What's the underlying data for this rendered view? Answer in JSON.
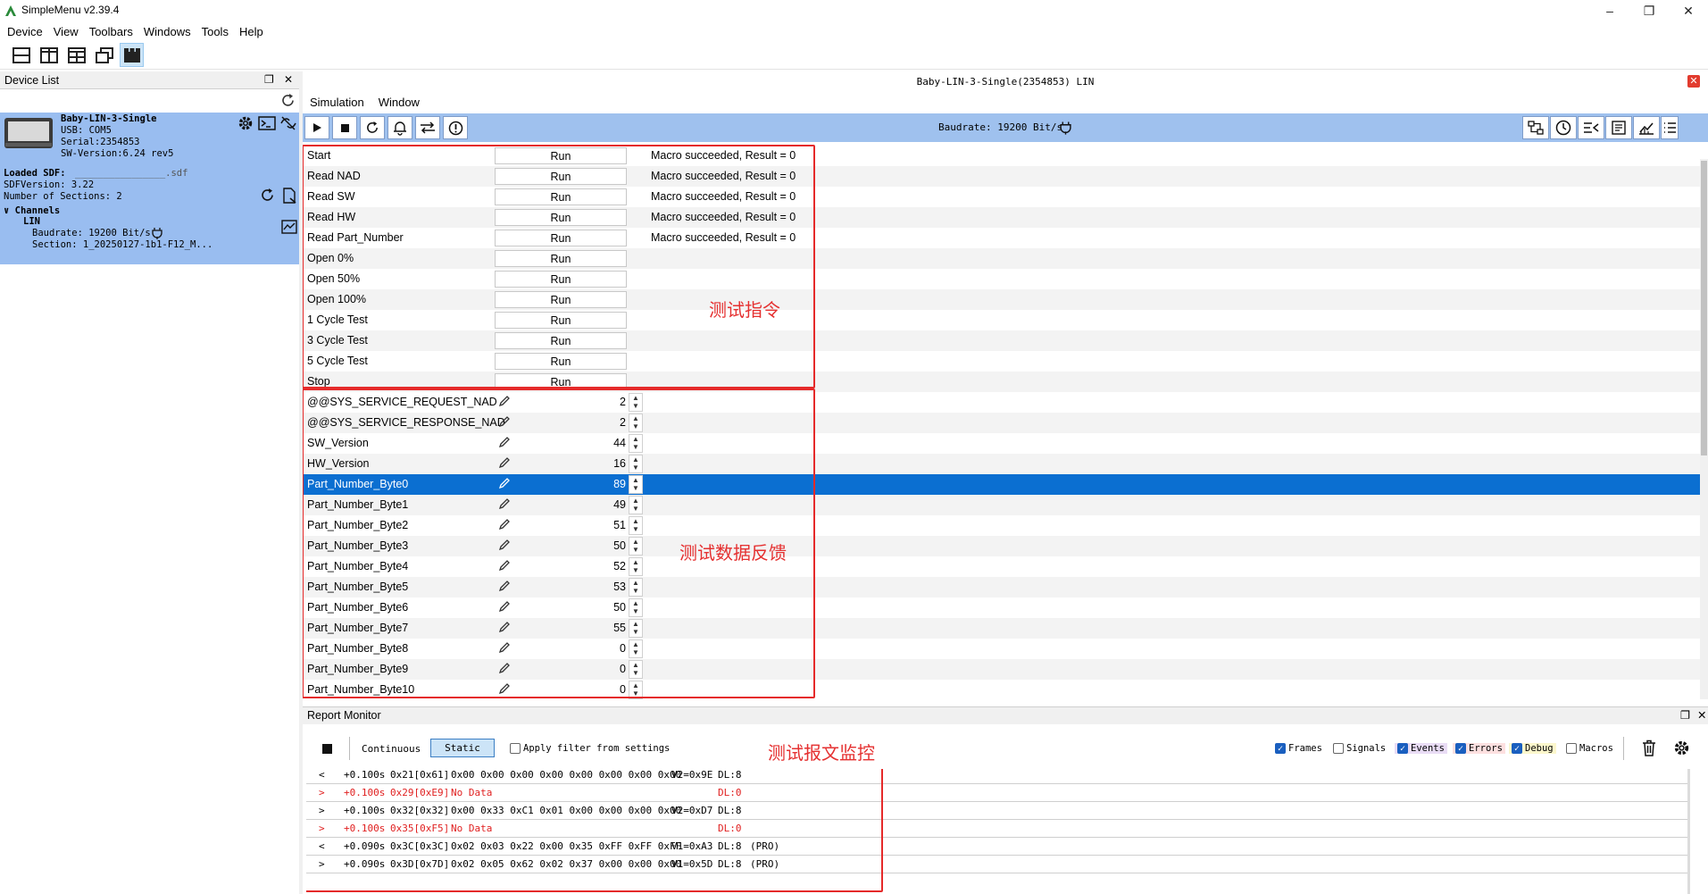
{
  "app": {
    "title": "SimpleMenu v2.39.4"
  },
  "menu": [
    "Device",
    "View",
    "Toolbars",
    "Windows",
    "Tools",
    "Help"
  ],
  "device_list": {
    "title": "Device List",
    "device": {
      "name": "Baby-LIN-3-Single",
      "usb": "USB: COM5",
      "serial": "Serial:2354853",
      "sw": "SW-Version:6.24 rev5",
      "loaded_sdf_label": "Loaded SDF:",
      "loaded_sdf_value": "________________.sdf",
      "sdf_version": "SDFVersion: 3.22",
      "num_sections": "Number of Sections: 2",
      "channels_label": "Channels",
      "channel": "LIN",
      "baudrate": "Baudrate: 19200 Bit/s",
      "section": "Section: 1_20250127-1b1-F12_M..."
    }
  },
  "sdf_window": {
    "title": "Baby-LIN-3-Single(2354853) LIN",
    "menu": [
      "Simulation",
      "Window"
    ],
    "baud": "Baudrate: 19200 Bit/s"
  },
  "macros": [
    {
      "label": "Start",
      "button": "Run",
      "result": "Macro succeeded, Result = 0"
    },
    {
      "label": "Read NAD",
      "button": "Run",
      "result": "Macro succeeded, Result = 0"
    },
    {
      "label": "Read SW",
      "button": "Run",
      "result": "Macro succeeded, Result = 0"
    },
    {
      "label": "Read HW",
      "button": "Run",
      "result": "Macro succeeded, Result = 0"
    },
    {
      "label": "Read Part_Number",
      "button": "Run",
      "result": "Macro succeeded, Result = 0"
    },
    {
      "label": "Open 0%",
      "button": "Run",
      "result": ""
    },
    {
      "label": "Open 50%",
      "button": "Run",
      "result": ""
    },
    {
      "label": "Open 100%",
      "button": "Run",
      "result": ""
    },
    {
      "label": "1 Cycle Test",
      "button": "Run",
      "result": ""
    },
    {
      "label": "3 Cycle Test",
      "button": "Run",
      "result": ""
    },
    {
      "label": "5 Cycle Test",
      "button": "Run",
      "result": ""
    },
    {
      "label": "Stop",
      "button": "Run",
      "result": ""
    }
  ],
  "signals": [
    {
      "label": "@@SYS_SERVICE_REQUEST_NAD",
      "value": "2"
    },
    {
      "label": "@@SYS_SERVICE_RESPONSE_NAD",
      "value": "2"
    },
    {
      "label": "SW_Version",
      "value": "44"
    },
    {
      "label": "HW_Version",
      "value": "16"
    },
    {
      "label": "Part_Number_Byte0",
      "value": "89"
    },
    {
      "label": "Part_Number_Byte1",
      "value": "49"
    },
    {
      "label": "Part_Number_Byte2",
      "value": "51"
    },
    {
      "label": "Part_Number_Byte3",
      "value": "50"
    },
    {
      "label": "Part_Number_Byte4",
      "value": "52"
    },
    {
      "label": "Part_Number_Byte5",
      "value": "53"
    },
    {
      "label": "Part_Number_Byte6",
      "value": "50"
    },
    {
      "label": "Part_Number_Byte7",
      "value": "55"
    },
    {
      "label": "Part_Number_Byte8",
      "value": "0"
    },
    {
      "label": "Part_Number_Byte9",
      "value": "0"
    },
    {
      "label": "Part_Number_Byte10",
      "value": "0"
    }
  ],
  "annotations": {
    "commands": "测试指令",
    "feedback": "测试数据反馈",
    "monitor": "测试报文监控"
  },
  "report_monitor": {
    "title": "Report Monitor",
    "continuous": "Continuous",
    "static": "Static",
    "apply_filter": "Apply filter from settings",
    "filters": [
      {
        "label": "Frames",
        "checked": true
      },
      {
        "label": "Signals",
        "checked": false
      },
      {
        "label": "Events",
        "checked": true
      },
      {
        "label": "Errors",
        "checked": true
      },
      {
        "label": "Debug",
        "checked": true
      },
      {
        "label": "Macros",
        "checked": false
      }
    ],
    "rows": [
      {
        "dir": "<",
        "time": "+0.100s",
        "id": "0x21[0x61]",
        "data": "0x00 0x00 0x00 0x00 0x00 0x00 0x00 0x00",
        "crc": "V2=0x9E",
        "dl": "DL:8",
        "extra": "",
        "error": false
      },
      {
        "dir": ">",
        "time": "+0.100s",
        "id": "0x29[0xE9]",
        "data": "No Data",
        "crc": "",
        "dl": "DL:0",
        "extra": "",
        "error": true
      },
      {
        "dir": ">",
        "time": "+0.100s",
        "id": "0x32[0x32]",
        "data": "0x00 0x33 0xC1 0x01 0x00 0x00 0x00 0x00",
        "crc": "V2=0xD7",
        "dl": "DL:8",
        "extra": "",
        "error": false
      },
      {
        "dir": ">",
        "time": "+0.100s",
        "id": "0x35[0xF5]",
        "data": "No Data",
        "crc": "",
        "dl": "DL:0",
        "extra": "",
        "error": true
      },
      {
        "dir": "<",
        "time": "+0.090s",
        "id": "0x3C[0x3C]",
        "data": "0x02 0x03 0x22 0x00 0x35 0xFF 0xFF 0xFF",
        "crc": "V1=0xA3",
        "dl": "DL:8",
        "extra": "(PRO)",
        "error": false
      },
      {
        "dir": ">",
        "time": "+0.090s",
        "id": "0x3D[0x7D]",
        "data": "0x02 0x05 0x62 0x02 0x37 0x00 0x00 0x00",
        "crc": "V1=0x5D",
        "dl": "DL:8",
        "extra": "(PRO)",
        "error": false
      }
    ]
  },
  "colors": {
    "selection": "#0b6fd1",
    "panel": "#99bdf0",
    "annotation": "#e53030"
  }
}
